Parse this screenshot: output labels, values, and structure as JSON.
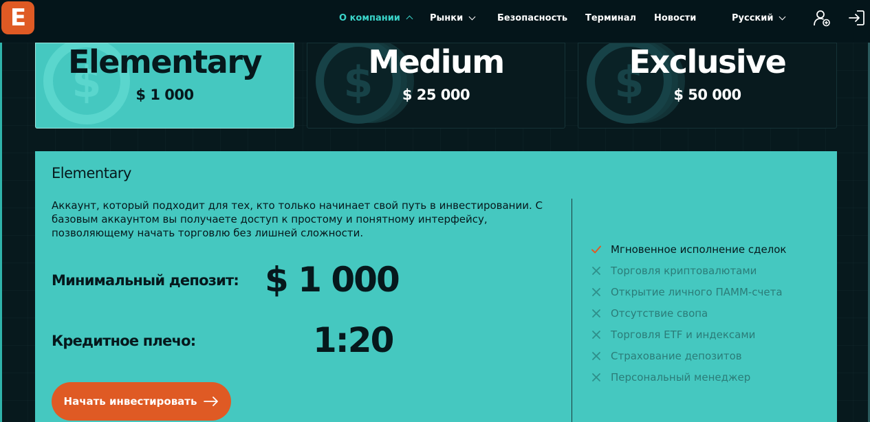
{
  "logo": {
    "letter": "E",
    "color": "#df5a24"
  },
  "nav": {
    "items": [
      {
        "label": "О компании",
        "active": true,
        "chevron": "up"
      },
      {
        "label": "Рынки",
        "active": false,
        "chevron": "down"
      },
      {
        "label": "Безопасность",
        "active": false,
        "chevron": null
      },
      {
        "label": "Терминал",
        "active": false,
        "chevron": null
      },
      {
        "label": "Новости",
        "active": false,
        "chevron": null
      }
    ],
    "language": "Русский",
    "icons": [
      "user-add-icon",
      "login-icon"
    ]
  },
  "plans": [
    {
      "name": "Elementary",
      "price": "$ 1 000",
      "selected": true,
      "icon": "coin-dollar-icon"
    },
    {
      "name": "Medium",
      "price": "$ 25 000",
      "selected": false,
      "icon": "coin-stack-dollar-icon"
    },
    {
      "name": "Exclusive",
      "price": "$ 50 000",
      "selected": false,
      "icon": "coin-stack-dollar-icon"
    }
  ],
  "detail": {
    "title": "Elementary",
    "description": "Аккаунт, который подходит для тех, кто только начинает свой путь в инвестировании. С базовым аккаунтом вы получаете доступ к простому и понятному интерфейсу, позволяющему начать торговлю без лишней сложности.",
    "min_deposit_label": "Минимальный депозит:",
    "min_deposit_value": "$ 1 000",
    "leverage_label": "Кредитное плечо:",
    "leverage_value": "1:20",
    "cta_label": "Начать инвестировать",
    "features": [
      {
        "label": "Мгновенное исполнение сделок",
        "included": true
      },
      {
        "label": "Торговля криптовалютами",
        "included": false
      },
      {
        "label": "Открытие личного ПАММ-счета",
        "included": false
      },
      {
        "label": "Отсутствие свопа",
        "included": false
      },
      {
        "label": "Торговля ETF и индексами",
        "included": false
      },
      {
        "label": "Страхование депозитов",
        "included": false
      },
      {
        "label": "Персональный менеджер",
        "included": false
      }
    ]
  },
  "colors": {
    "accent": "#45c8c0",
    "active_nav": "#3ad4c9",
    "cta": "#df5a24",
    "check": "#df5a24",
    "background": "#06181c"
  }
}
